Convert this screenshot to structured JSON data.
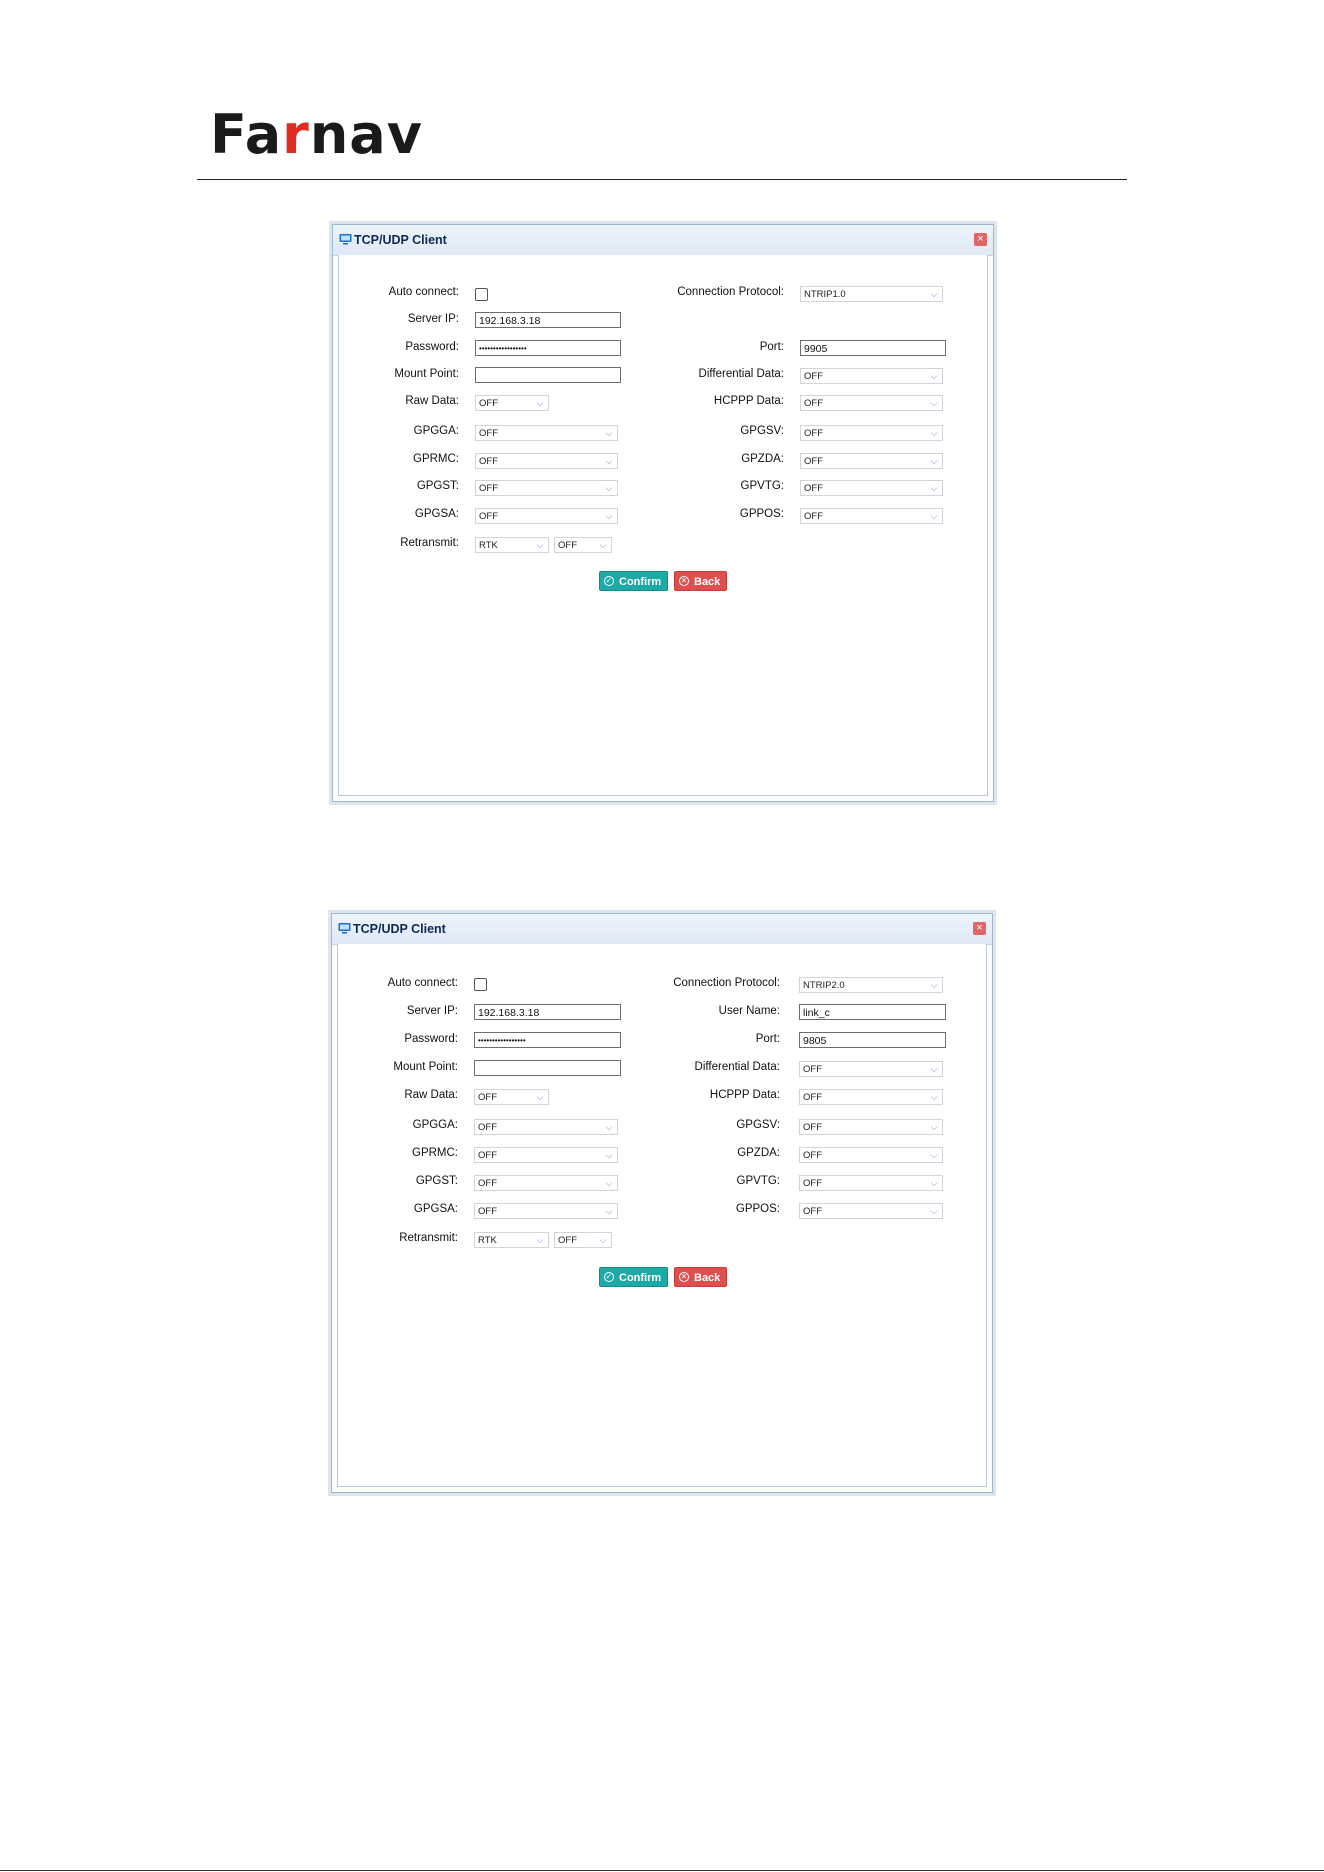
{
  "logo": {
    "part1": "Fa",
    "part2": "r",
    "part3": "nav"
  },
  "dialogs": [
    {
      "title": "TCP/UDP Client",
      "auto_connect_label": "Auto connect:",
      "connection_protocol_label": "Connection Protocol:",
      "connection_protocol_value": "NTRIP1.0",
      "server_ip_label": "Server IP:",
      "server_ip_value": "192.168.3.18",
      "password_label": "Password:",
      "password_value": "•••••••••••••••••",
      "port_label": "Port:",
      "port_value": "9905",
      "mount_point_label": "Mount Point:",
      "mount_point_value": "",
      "differential_data_label": "Differential Data:",
      "differential_data_value": "OFF",
      "raw_data_label": "Raw Data:",
      "raw_data_value": "OFF",
      "hcppp_label": "HCPPP Data:",
      "hcppp_value": "OFF",
      "gpgga_label": "GPGGA:",
      "gpgga_value": "OFF",
      "gpgsv_label": "GPGSV:",
      "gpgsv_value": "OFF",
      "gprmc_label": "GPRMC:",
      "gprmc_value": "OFF",
      "gpzda_label": "GPZDA:",
      "gpzda_value": "OFF",
      "gpgst_label": "GPGST:",
      "gpgst_value": "OFF",
      "gpvtg_label": "GPVTG:",
      "gpvtg_value": "OFF",
      "gpgsa_label": "GPGSA:",
      "gpgsa_value": "OFF",
      "gppos_label": "GPPOS:",
      "gppos_value": "OFF",
      "retransmit_label": "Retransmit:",
      "retransmit_value1": "RTK",
      "retransmit_value2": "OFF",
      "confirm_label": "Confirm",
      "back_label": "Back"
    },
    {
      "title": "TCP/UDP Client",
      "auto_connect_label": "Auto connect:",
      "connection_protocol_label": "Connection Protocol:",
      "connection_protocol_value": "NTRIP2.0",
      "server_ip_label": "Server IP:",
      "server_ip_value": "192.168.3.18",
      "username_label": "User Name:",
      "username_value": "link_c",
      "password_label": "Password:",
      "password_value": "•••••••••••••••••",
      "port_label": "Port:",
      "port_value": "9805",
      "mount_point_label": "Mount Point:",
      "mount_point_value": "",
      "differential_data_label": "Differential Data:",
      "differential_data_value": "OFF",
      "raw_data_label": "Raw Data:",
      "raw_data_value": "OFF",
      "hcppp_label": "HCPPP Data:",
      "hcppp_value": "OFF",
      "gpgga_label": "GPGGA:",
      "gpgga_value": "OFF",
      "gpgsv_label": "GPGSV:",
      "gpgsv_value": "OFF",
      "gprmc_label": "GPRMC:",
      "gprmc_value": "OFF",
      "gpzda_label": "GPZDA:",
      "gpzda_value": "OFF",
      "gpgst_label": "GPGST:",
      "gpgst_value": "OFF",
      "gpvtg_label": "GPVTG:",
      "gpvtg_value": "OFF",
      "gpgsa_label": "GPGSA:",
      "gpgsa_value": "OFF",
      "gppos_label": "GPPOS:",
      "gppos_value": "OFF",
      "retransmit_label": "Retransmit:",
      "retransmit_value1": "RTK",
      "retransmit_value2": "OFF",
      "confirm_label": "Confirm",
      "back_label": "Back"
    }
  ],
  "colors": {
    "confirm": "#1daaa6",
    "back": "#e04e4e",
    "brand_accent": "#e02b20",
    "title_text": "#0d2a55"
  },
  "icons": {
    "title": "monitor-icon",
    "close": "close-icon",
    "confirm": "check-circle-icon",
    "back": "x-circle-icon",
    "dropdown": "chevron-down-icon"
  }
}
